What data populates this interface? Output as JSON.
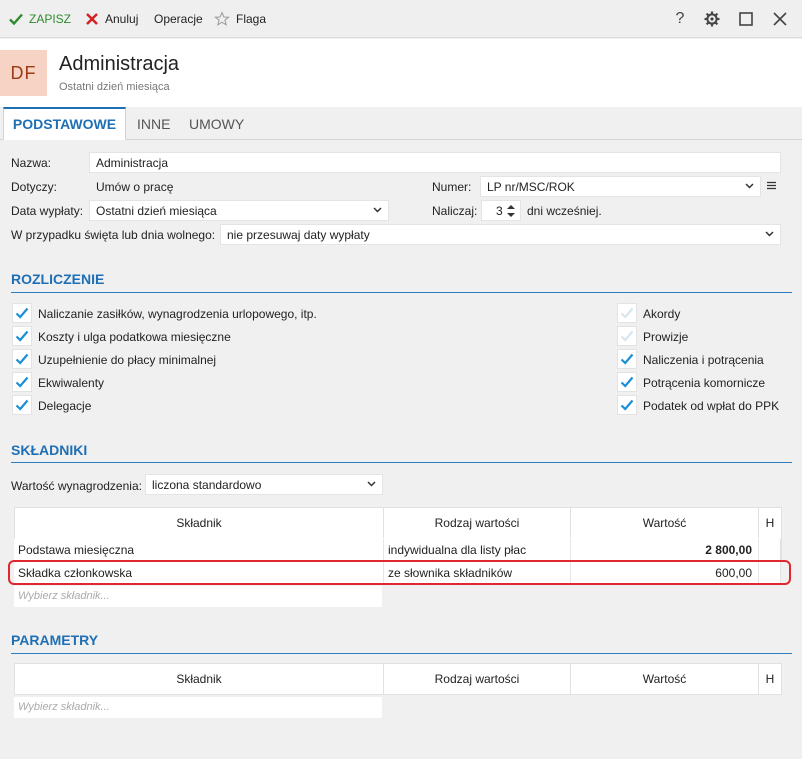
{
  "toolbar": {
    "save_label": "ZAPISZ",
    "cancel_label": "Anuluj",
    "operations_label": "Operacje",
    "flag_label": "Flaga",
    "help_label": "?"
  },
  "header": {
    "avatar": "DF",
    "title": "Administracja",
    "subtitle": "Ostatni dzień miesiąca"
  },
  "tabs": [
    {
      "label": "PODSTAWOWE",
      "active": true
    },
    {
      "label": "INNE",
      "active": false
    },
    {
      "label": "UMOWY",
      "active": false
    }
  ],
  "form": {
    "name_label": "Nazwa:",
    "name_value": "Administracja",
    "applies_label": "Dotyczy:",
    "applies_value": "Umów o pracę",
    "number_label": "Numer:",
    "number_value": "LP nr/MSC/ROK",
    "payout_label": "Data wypłaty:",
    "payout_value": "Ostatni dzień miesiąca",
    "accrue_label": "Naliczaj:",
    "accrue_value": "3",
    "accrue_suffix": "dni wcześniej.",
    "holiday_label": "W przypadku święta lub dnia wolnego:",
    "holiday_value": "nie przesuwaj daty wypłaty"
  },
  "settlement": {
    "title": "ROZLICZENIE",
    "left": [
      {
        "label": "Naliczanie zasiłków, wynagrodzenia urlopowego, itp.",
        "checked": true
      },
      {
        "label": "Koszty i ulga podatkowa miesięczne",
        "checked": true
      },
      {
        "label": "Uzupełnienie do płacy minimalnej",
        "checked": true
      },
      {
        "label": "Ekwiwalenty",
        "checked": true
      },
      {
        "label": "Delegacje",
        "checked": true
      }
    ],
    "right": [
      {
        "label": "Akordy",
        "checked": false
      },
      {
        "label": "Prowizje",
        "checked": false
      },
      {
        "label": "Naliczenia i potrącenia",
        "checked": true
      },
      {
        "label": "Potrącenia komornicze",
        "checked": true
      },
      {
        "label": "Podatek od wpłat do PPK",
        "checked": true
      }
    ]
  },
  "components": {
    "title": "SKŁADNIKI",
    "salary_label": "Wartość wynagrodzenia:",
    "salary_value": "liczona standardowo",
    "columns": [
      "Składnik",
      "Rodzaj wartości",
      "Wartość",
      "H"
    ],
    "rows": [
      {
        "name": "Podstawa miesięczna",
        "kind": "indywidualna dla listy płac",
        "value": "2 800,00",
        "bold": true
      },
      {
        "name": "Składka członkowska",
        "kind": "ze słownika składników",
        "value": "600,00",
        "bold": false
      }
    ],
    "placeholder": "Wybierz składnik..."
  },
  "parameters": {
    "title": "PARAMETRY",
    "columns": [
      "Składnik",
      "Rodzaj wartości",
      "Wartość",
      "H"
    ],
    "placeholder": "Wybierz składnik..."
  },
  "colors": {
    "accent": "#1f6fb5",
    "check": "#1a8fd6",
    "save_green": "#2e8b2e",
    "cancel_red": "#d42020",
    "highlight": "#e0262f"
  }
}
